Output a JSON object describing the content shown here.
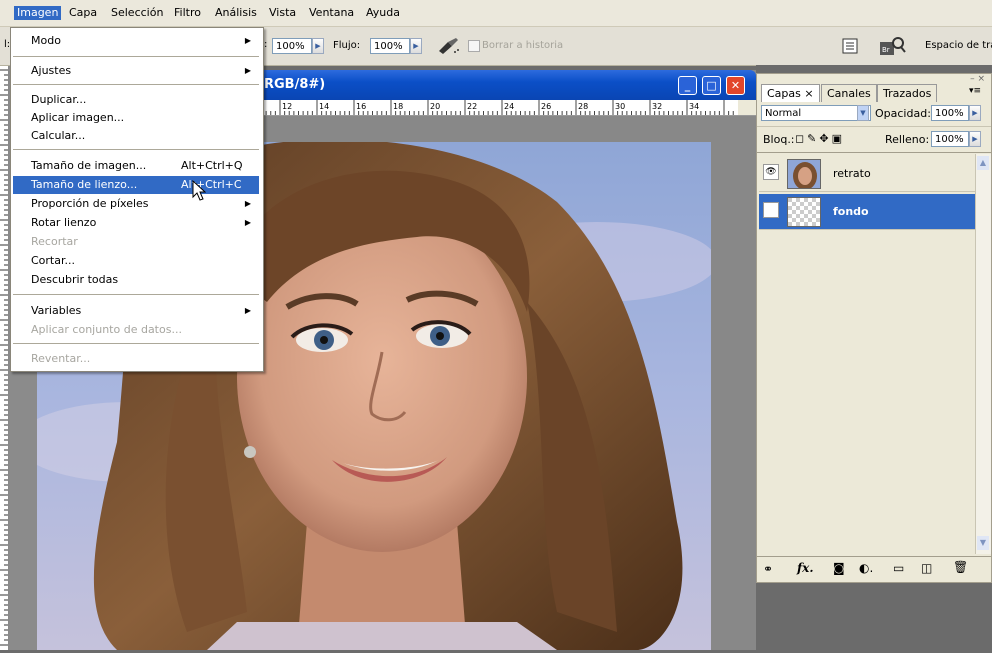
{
  "menubar": {
    "items": [
      "Imagen",
      "Capa",
      "Selección",
      "Filtro",
      "Análisis",
      "Vista",
      "Ventana",
      "Ayuda"
    ]
  },
  "options_bar": {
    "cut_label": "l:",
    "opacity_value": "100%",
    "flow_label": "Flujo:",
    "flow_value": "100%",
    "erase_history_label": "Borrar a historia",
    "workspace_label": "Espacio de tra"
  },
  "document": {
    "title": "RGB/8#)",
    "ruler_ticks": [
      "12",
      "14",
      "16",
      "18",
      "20",
      "22",
      "24",
      "26",
      "28",
      "30",
      "32",
      "34"
    ]
  },
  "image_menu": {
    "items": [
      {
        "label": "Modo",
        "submenu": true
      },
      {
        "label": "Ajustes",
        "submenu": true
      },
      {
        "label": "Duplicar..."
      },
      {
        "label": "Aplicar imagen..."
      },
      {
        "label": "Calcular..."
      },
      {
        "label": "Tamaño de imagen...",
        "shortcut": "Alt+Ctrl+Q"
      },
      {
        "label": "Tamaño de lienzo...",
        "shortcut": "Alt+Ctrl+C",
        "highlighted": true
      },
      {
        "label": "Proporción de píxeles",
        "submenu": true
      },
      {
        "label": "Rotar lienzo",
        "submenu": true
      },
      {
        "label": "Recortar",
        "disabled": true
      },
      {
        "label": "Cortar..."
      },
      {
        "label": "Descubrir todas"
      },
      {
        "label": "Variables",
        "submenu": true
      },
      {
        "label": "Aplicar conjunto de datos...",
        "disabled": true
      },
      {
        "label": "Reventar...",
        "disabled": true
      }
    ]
  },
  "layers_panel": {
    "tabs": [
      "Capas",
      "Canales",
      "Trazados"
    ],
    "blend_mode": "Normal",
    "opacity_label": "Opacidad:",
    "opacity_value": "100%",
    "lock_label": "Bloq.:",
    "fill_label": "Relleno:",
    "fill_value": "100%",
    "layers": [
      {
        "name": "retrato",
        "selected": false
      },
      {
        "name": "fondo",
        "selected": true
      }
    ]
  },
  "colors": {
    "menu_highlight": "#316ac5",
    "titlebar_blue": "#0b4fc7",
    "close_button": "#e2462a"
  }
}
